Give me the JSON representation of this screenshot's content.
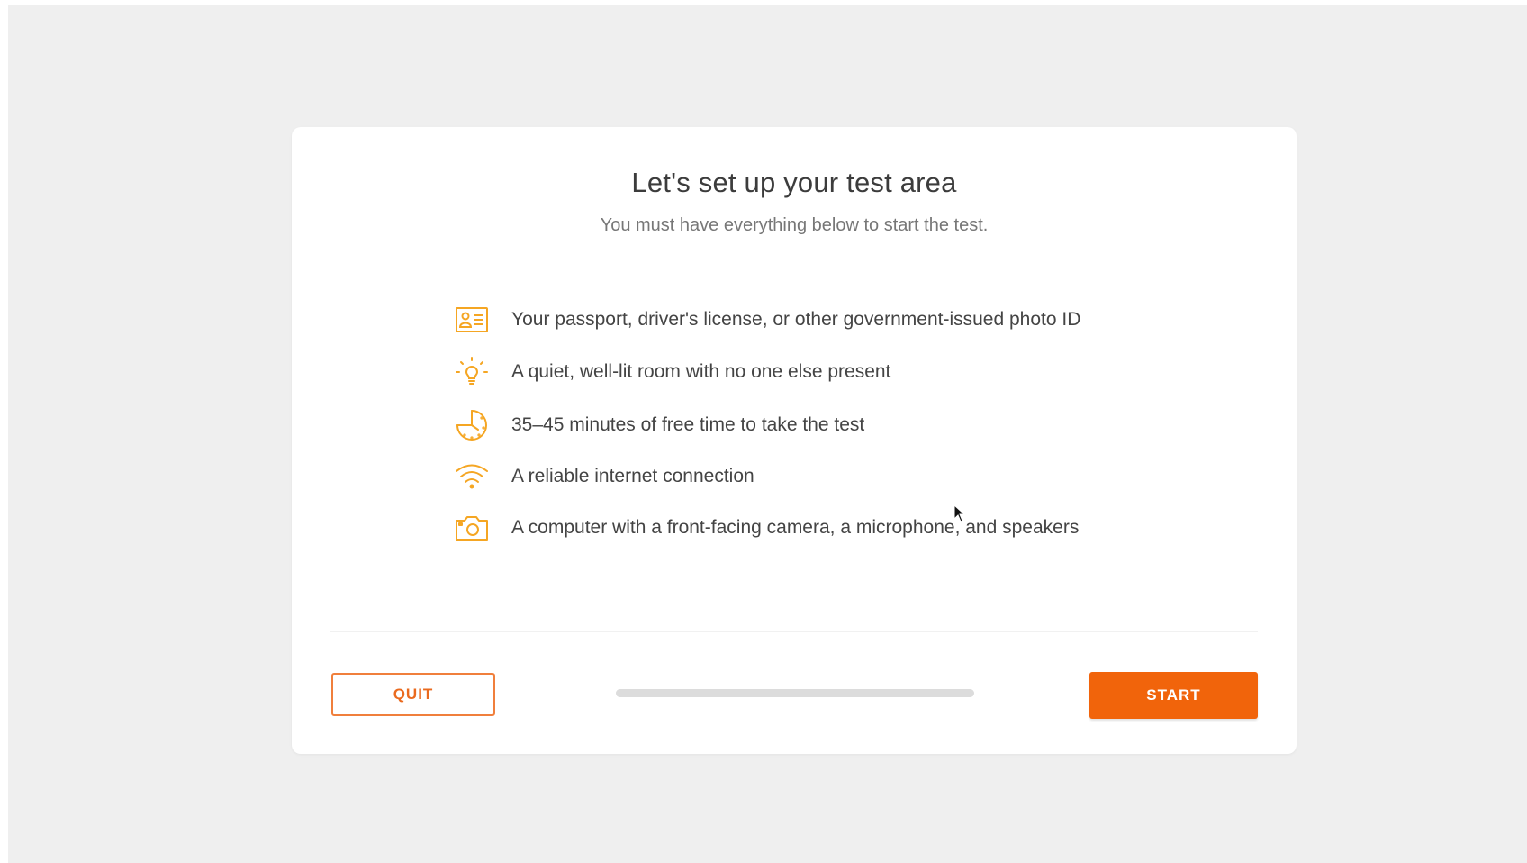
{
  "header": {
    "title": "Let's set up your test area",
    "subtitle": "You must have everything below to start the test."
  },
  "requirements": [
    {
      "icon": "id-card-icon",
      "text": "Your passport, driver's license, or other government-issued photo ID"
    },
    {
      "icon": "lightbulb-icon",
      "text": "A quiet, well-lit room with no one else present"
    },
    {
      "icon": "clock-icon",
      "text": "35–45 minutes of free time to take the test"
    },
    {
      "icon": "wifi-icon",
      "text": "A reliable internet connection"
    },
    {
      "icon": "camera-icon",
      "text": "A computer with a front-facing camera, a microphone, and speakers"
    }
  ],
  "footer": {
    "quit_label": "QUIT",
    "start_label": "START",
    "progress_fraction": 1.0
  },
  "colors": {
    "accent": "#f1640b",
    "icon": "#f5a623",
    "background": "#efefef"
  }
}
